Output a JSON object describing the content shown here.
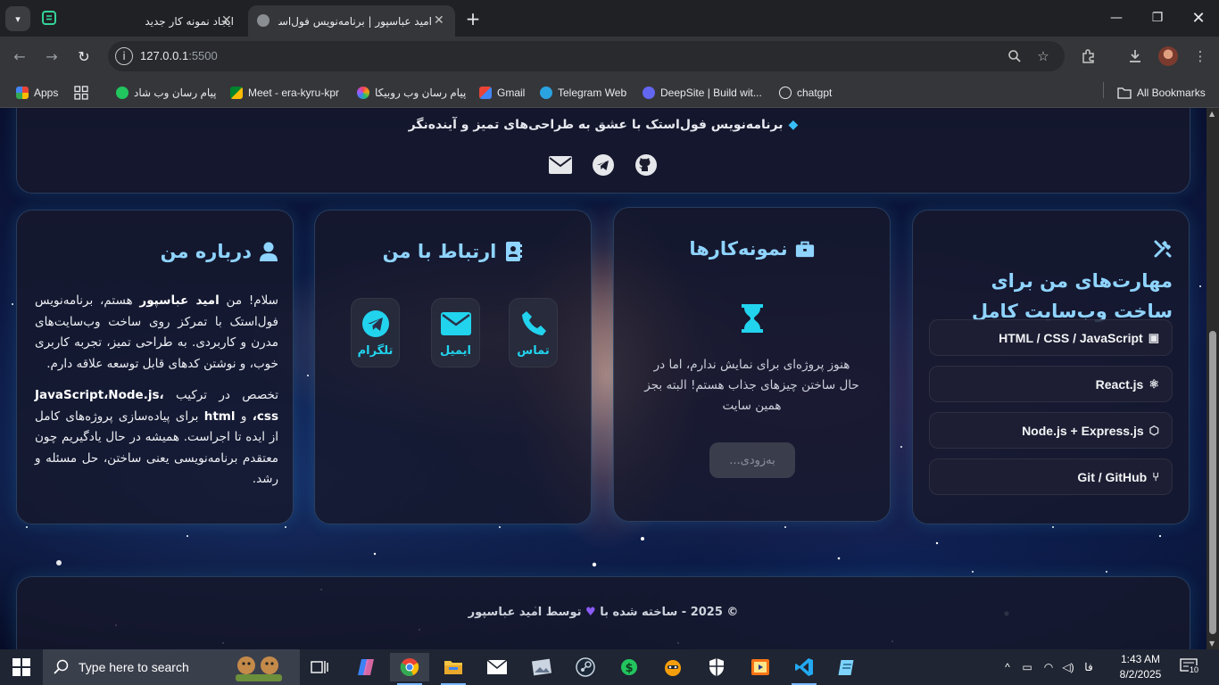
{
  "browser": {
    "tabs": [
      {
        "title": "ایجاد نمونه کار جدید"
      },
      {
        "title": "امید عباسپور | برنامه‌نویس فول‌استک"
      }
    ],
    "url": {
      "host": "127.0.0.1",
      "port": ":5500"
    },
    "bookmarks": [
      {
        "label": "Apps"
      },
      {
        "label": "پیام رسان وب شاد"
      },
      {
        "label": "Meet - era-kyru-kpr"
      },
      {
        "label": "پیام رسان وب روبیکا"
      },
      {
        "label": "Gmail"
      },
      {
        "label": "Telegram Web"
      },
      {
        "label": "DeepSite | Build wit..."
      },
      {
        "label": "chatgpt"
      }
    ],
    "all_bookmarks": "All Bookmarks"
  },
  "hero": {
    "tagline": "برنامه‌نویس فول‌استک با عشق به طراحی‌های تمیز و آینده‌نگر",
    "social_icons": [
      "email-icon",
      "telegram-icon",
      "github-icon"
    ]
  },
  "skills": {
    "title": "مهارت‌های من برای ساخت وب‌سایت کامل",
    "items": [
      {
        "label": "HTML / CSS / JavaScript",
        "icon": "html5-icon"
      },
      {
        "label": "React.js",
        "icon": "react-icon"
      },
      {
        "label": "Node.js + Express.js",
        "icon": "nodejs-icon"
      },
      {
        "label": "Git / GitHub",
        "icon": "git-branch-icon"
      }
    ]
  },
  "projects": {
    "title": "نمونه‌کارها",
    "empty_text": "هنوز پروژه‌ای برای نمایش ندارم، اما در حال ساختن چیزهای جذاب هستم! البته بجز همین سایت",
    "soon_button": "به‌زودی..."
  },
  "contact": {
    "title": "ارتباط با من",
    "buttons": [
      {
        "label": "تماس",
        "icon": "phone-icon"
      },
      {
        "label": "ایمیل",
        "icon": "envelope-icon"
      },
      {
        "label": "تلگرام",
        "icon": "telegram-icon"
      }
    ]
  },
  "about": {
    "title": "درباره من",
    "p1_a": "سلام! من ",
    "p1_name": "امید عباسپور",
    "p1_b": " هستم، برنامه‌نویس فول‌استک با تمرکز روی ساخت وب‌سایت‌های مدرن و کاربردی. به طراحی تمیز، تجربه کاربری خوب، و نوشتن کدهای قابل توسعه علاقه دارم.",
    "p2_a": "تخصص در ترکیب ",
    "p2_tech": "JavaScript،Node.js، css،",
    "p2_b": " و ",
    "p2_html": "html",
    "p2_c": " برای پیاده‌سازی پروژه‌های کامل از ایده تا اجراست. همیشه در حال یادگیریم چون معتقدم برنامه‌نویسی یعنی ساختن، حل مسئله و رشد."
  },
  "footer": {
    "text_a": "© 2025 - ساخته شده با",
    "text_b": "توسط امید عباسپور"
  },
  "taskbar": {
    "search_placeholder": "Type here to search",
    "lang": "فا",
    "time": "1:43 AM",
    "date": "8/2/2025",
    "notifications": "10"
  }
}
